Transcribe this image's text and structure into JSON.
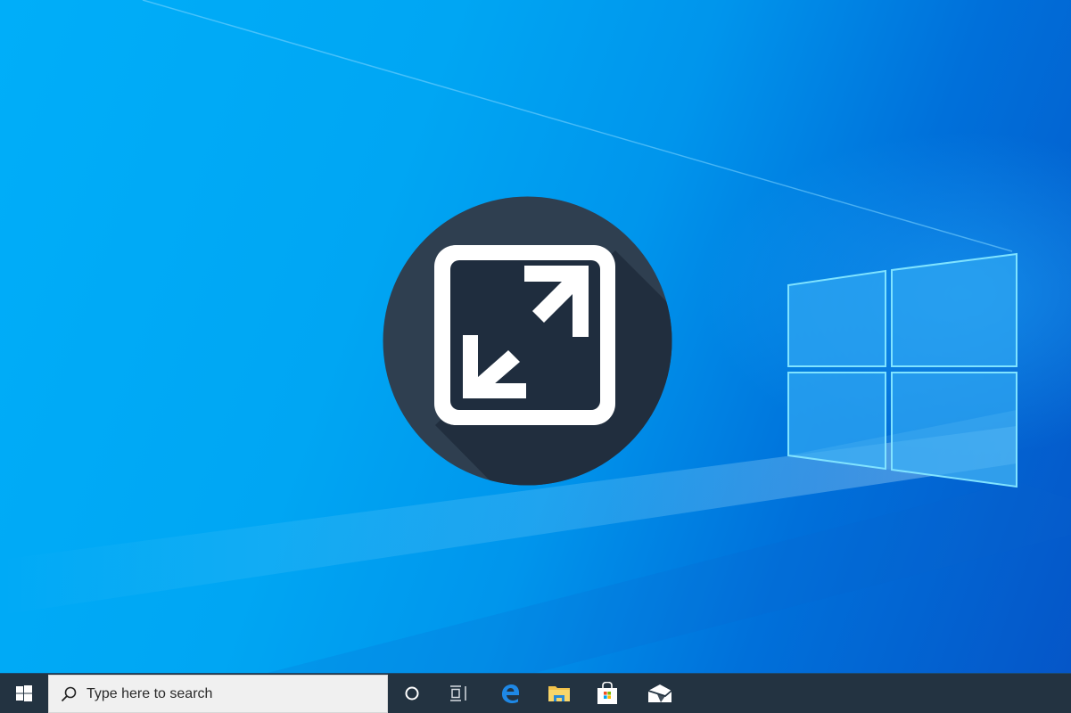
{
  "desktop": {
    "wallpaper": "windows-10-hero",
    "featured_icon": {
      "name": "maximize-fullscreen-icon",
      "circle_color": "#2f3f50",
      "tile_color": "#1f2d3e",
      "glyph_color": "#ffffff"
    },
    "colors": {
      "bg_light": "#00aef9",
      "bg_dark": "#0556c8",
      "logo_pane": "#2ea6f2",
      "logo_edge": "#7fe3ff"
    }
  },
  "taskbar": {
    "background": "#233341",
    "start_button": {
      "icon": "windows-start-icon",
      "label": "Start"
    },
    "search": {
      "icon": "search-icon",
      "placeholder": "Type here to search"
    },
    "buttons": [
      {
        "id": "cortana",
        "icon": "cortana-circle-icon",
        "label": "Cortana"
      },
      {
        "id": "task-view",
        "icon": "task-view-icon",
        "label": "Task View"
      },
      {
        "id": "edge",
        "icon": "edge-browser-icon",
        "label": "Microsoft Edge"
      },
      {
        "id": "file-explorer",
        "icon": "file-explorer-folder-icon",
        "label": "File Explorer"
      },
      {
        "id": "store",
        "icon": "microsoft-store-bag-icon",
        "label": "Microsoft Store"
      },
      {
        "id": "mail",
        "icon": "mail-envelope-icon",
        "label": "Mail"
      }
    ]
  }
}
